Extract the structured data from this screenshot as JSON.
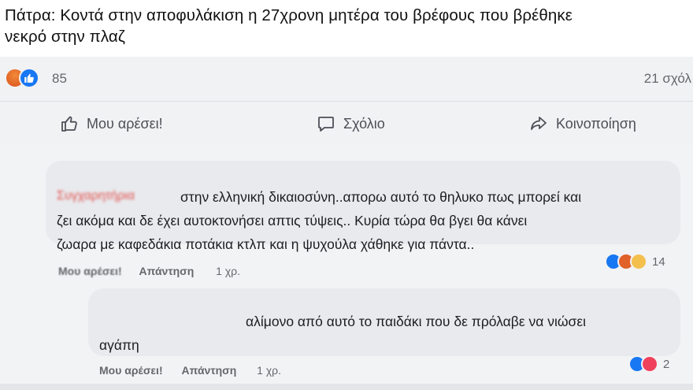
{
  "post": {
    "title_line1": "Πάτρα: Κοντά στην αποφυλάκιση η 27χρονη μητέρα του βρέφους που βρέθηκε",
    "title_line2": "νεκρό στην πλαζ",
    "reaction_icons": [
      "angry-reaction-icon",
      "like-reaction-icon"
    ],
    "reaction_count": "85",
    "comments_count": "21 σχόλ"
  },
  "actions": {
    "like_label": "Μου αρέσει!",
    "comment_label": "Σχόλιο",
    "share_label": "Κοινοποίηση"
  },
  "comments": [
    {
      "author": "Συγχαρητήρια",
      "line1": "στην ελληνική δικαιοσύνη..απορω αυτό το θηλυκο πως μπορεί και",
      "line2": "ζει ακόμα και δε έχει αυτοκτονήσει απτις τύψεις.. Κυρία τώρα θα βγει θα κάνει",
      "line3": "ζωαρα με καφεδάκια ποτάκια κτλπ και η ψυχούλα χάθηκε για πάντα..",
      "reactions": [
        "like",
        "angry",
        "sad"
      ],
      "reaction_count": "14",
      "like_label": "Μου αρέσει!",
      "reply_label": "Απάντηση",
      "time": "1 χρ."
    },
    {
      "line1": "αλίμονο από αυτό το παιδάκι που δε πρόλαβε να νιώσει",
      "line2": "αγάπη",
      "reactions": [
        "like",
        "love"
      ],
      "reaction_count": "2",
      "like_label": "Μου αρέσει!",
      "reply_label": "Απάντηση",
      "time": "1 χρ."
    }
  ],
  "colors": {
    "like_blue": "#1877f2",
    "angry_orange": "#e0612a",
    "love_red": "#f0415b",
    "sad_yellow": "#f3c04d",
    "muted_text": "#65676b"
  }
}
